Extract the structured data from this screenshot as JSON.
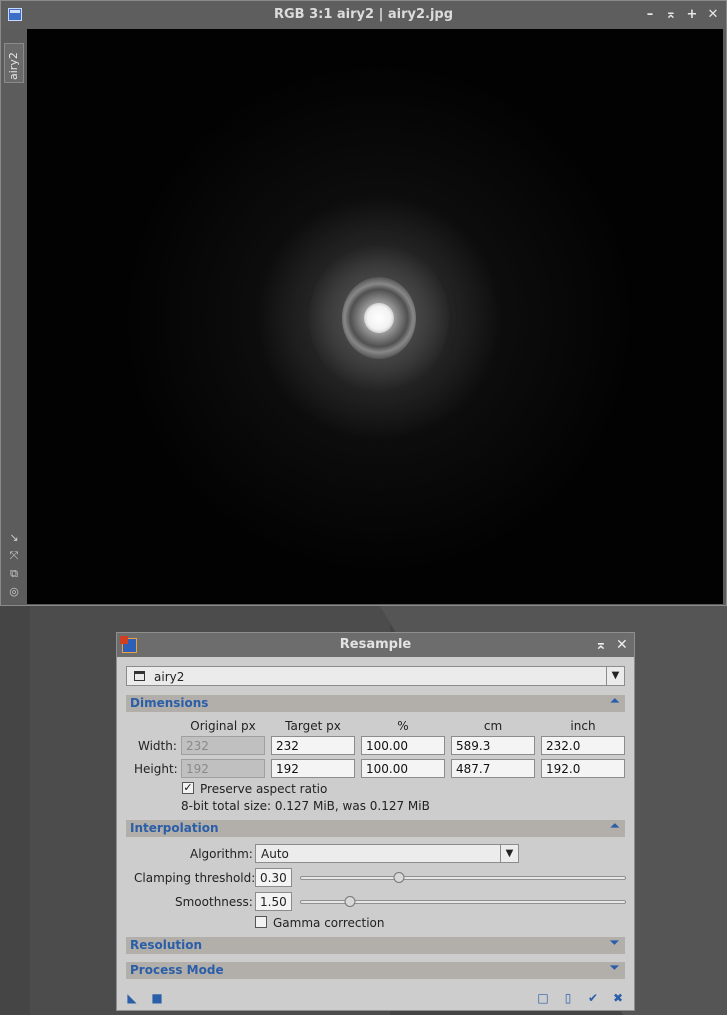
{
  "image_window": {
    "title": "RGB 3:1 airy2 | airy2.jpg",
    "side_tab_label": "airy2",
    "title_buttons": [
      "minimize-icon",
      "shade-icon",
      "maximize-icon",
      "close-icon"
    ],
    "side_icons": [
      "zoom-icon",
      "fit-icon",
      "clone-icon",
      "target-icon"
    ]
  },
  "dialog": {
    "title": "Resample",
    "view_select": "airy2",
    "sections": {
      "dimensions": "Dimensions",
      "interpolation": "Interpolation",
      "resolution": "Resolution",
      "process_mode": "Process Mode"
    },
    "columns": [
      "Original px",
      "Target px",
      "%",
      "cm",
      "inch"
    ],
    "rows": [
      {
        "label": "Width:",
        "original": "232",
        "target": "232",
        "percent": "100.00",
        "cm": "589.3",
        "inch": "232.0"
      },
      {
        "label": "Height:",
        "original": "192",
        "target": "192",
        "percent": "100.00",
        "cm": "487.7",
        "inch": "192.0"
      }
    ],
    "preserve_aspect": {
      "label": "Preserve aspect ratio",
      "checked": true
    },
    "total_size": "8-bit total size: 0.127 MiB, was 0.127 MiB",
    "algorithm": {
      "label": "Algorithm:",
      "value": "Auto"
    },
    "clamping": {
      "label": "Clamping threshold:",
      "value": "0.30",
      "slider_fraction": 0.3
    },
    "smoothness": {
      "label": "Smoothness:",
      "value": "1.50",
      "slider_fraction": 0.15
    },
    "gamma": {
      "label": "Gamma correction",
      "checked": false
    },
    "bottom_icons": [
      "new-instance-icon",
      "apply-global-icon",
      "preview-icon",
      "reset-icon",
      "apply-icon",
      "cancel-icon"
    ]
  }
}
